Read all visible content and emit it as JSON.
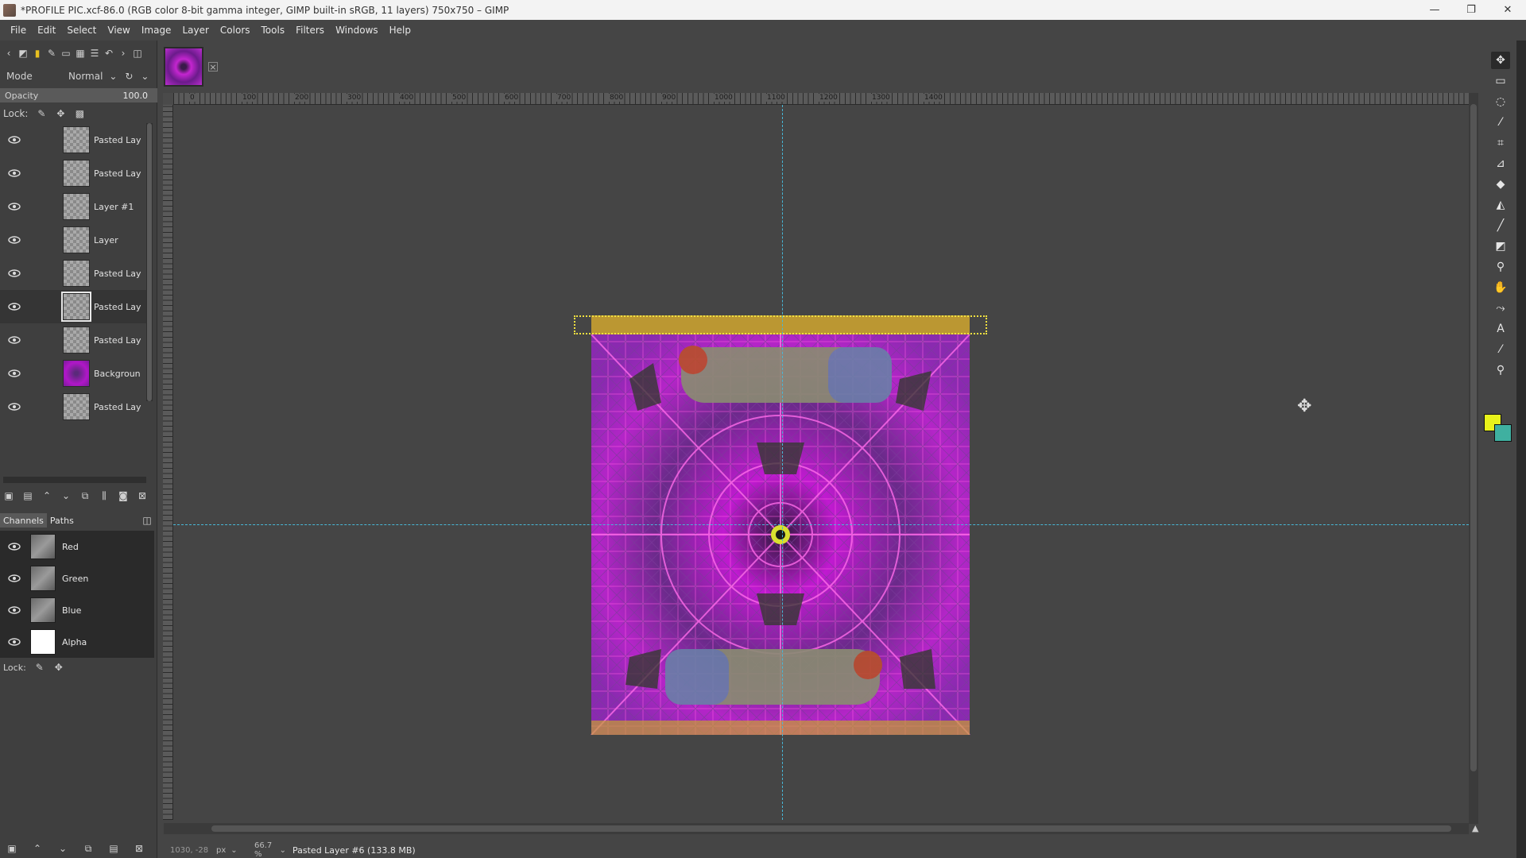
{
  "titlebar": {
    "title": "*PROFILE PIC.xcf-86.0 (RGB color 8-bit gamma integer, GIMP built-in sRGB, 11 layers) 750x750 – GIMP",
    "minimize": "—",
    "maximize": "❐",
    "close": "✕"
  },
  "menu": [
    "File",
    "Edit",
    "Select",
    "View",
    "Image",
    "Layer",
    "Colors",
    "Tools",
    "Filters",
    "Windows",
    "Help"
  ],
  "layers_panel": {
    "mode_label": "Mode",
    "mode_value": "Normal",
    "opacity_label": "Opacity",
    "opacity_value": "100.0",
    "lock_label": "Lock:",
    "layers": [
      {
        "name": "Pasted Lay",
        "active": false
      },
      {
        "name": "Pasted Lay",
        "active": false
      },
      {
        "name": "Layer #1",
        "active": false
      },
      {
        "name": "Layer",
        "active": false
      },
      {
        "name": "Pasted Lay",
        "active": false
      },
      {
        "name": "Pasted Lay",
        "active": true
      },
      {
        "name": "Pasted Lay",
        "active": false
      },
      {
        "name": "Backgroun",
        "active": false
      },
      {
        "name": "Pasted Lay",
        "active": false
      }
    ]
  },
  "channels_panel": {
    "tabs": [
      "Channels",
      "Paths"
    ],
    "channels": [
      "Red",
      "Green",
      "Blue",
      "Alpha"
    ],
    "lock_label": "Lock:"
  },
  "ruler": {
    "h_ticks": [
      "0",
      "100",
      "200",
      "300",
      "400",
      "500",
      "600",
      "700",
      "800",
      "900",
      "1000",
      "1100",
      "1200",
      "1300",
      "1400"
    ]
  },
  "statusbar": {
    "coords": "1030, -28",
    "units": "px",
    "zoom": "66.7 %",
    "message": "Pasted Layer #6 (133.8 MB)"
  },
  "colors": {
    "foreground": "#e8f21a",
    "background": "#3fb0a0",
    "guide": "#48b8d8"
  }
}
